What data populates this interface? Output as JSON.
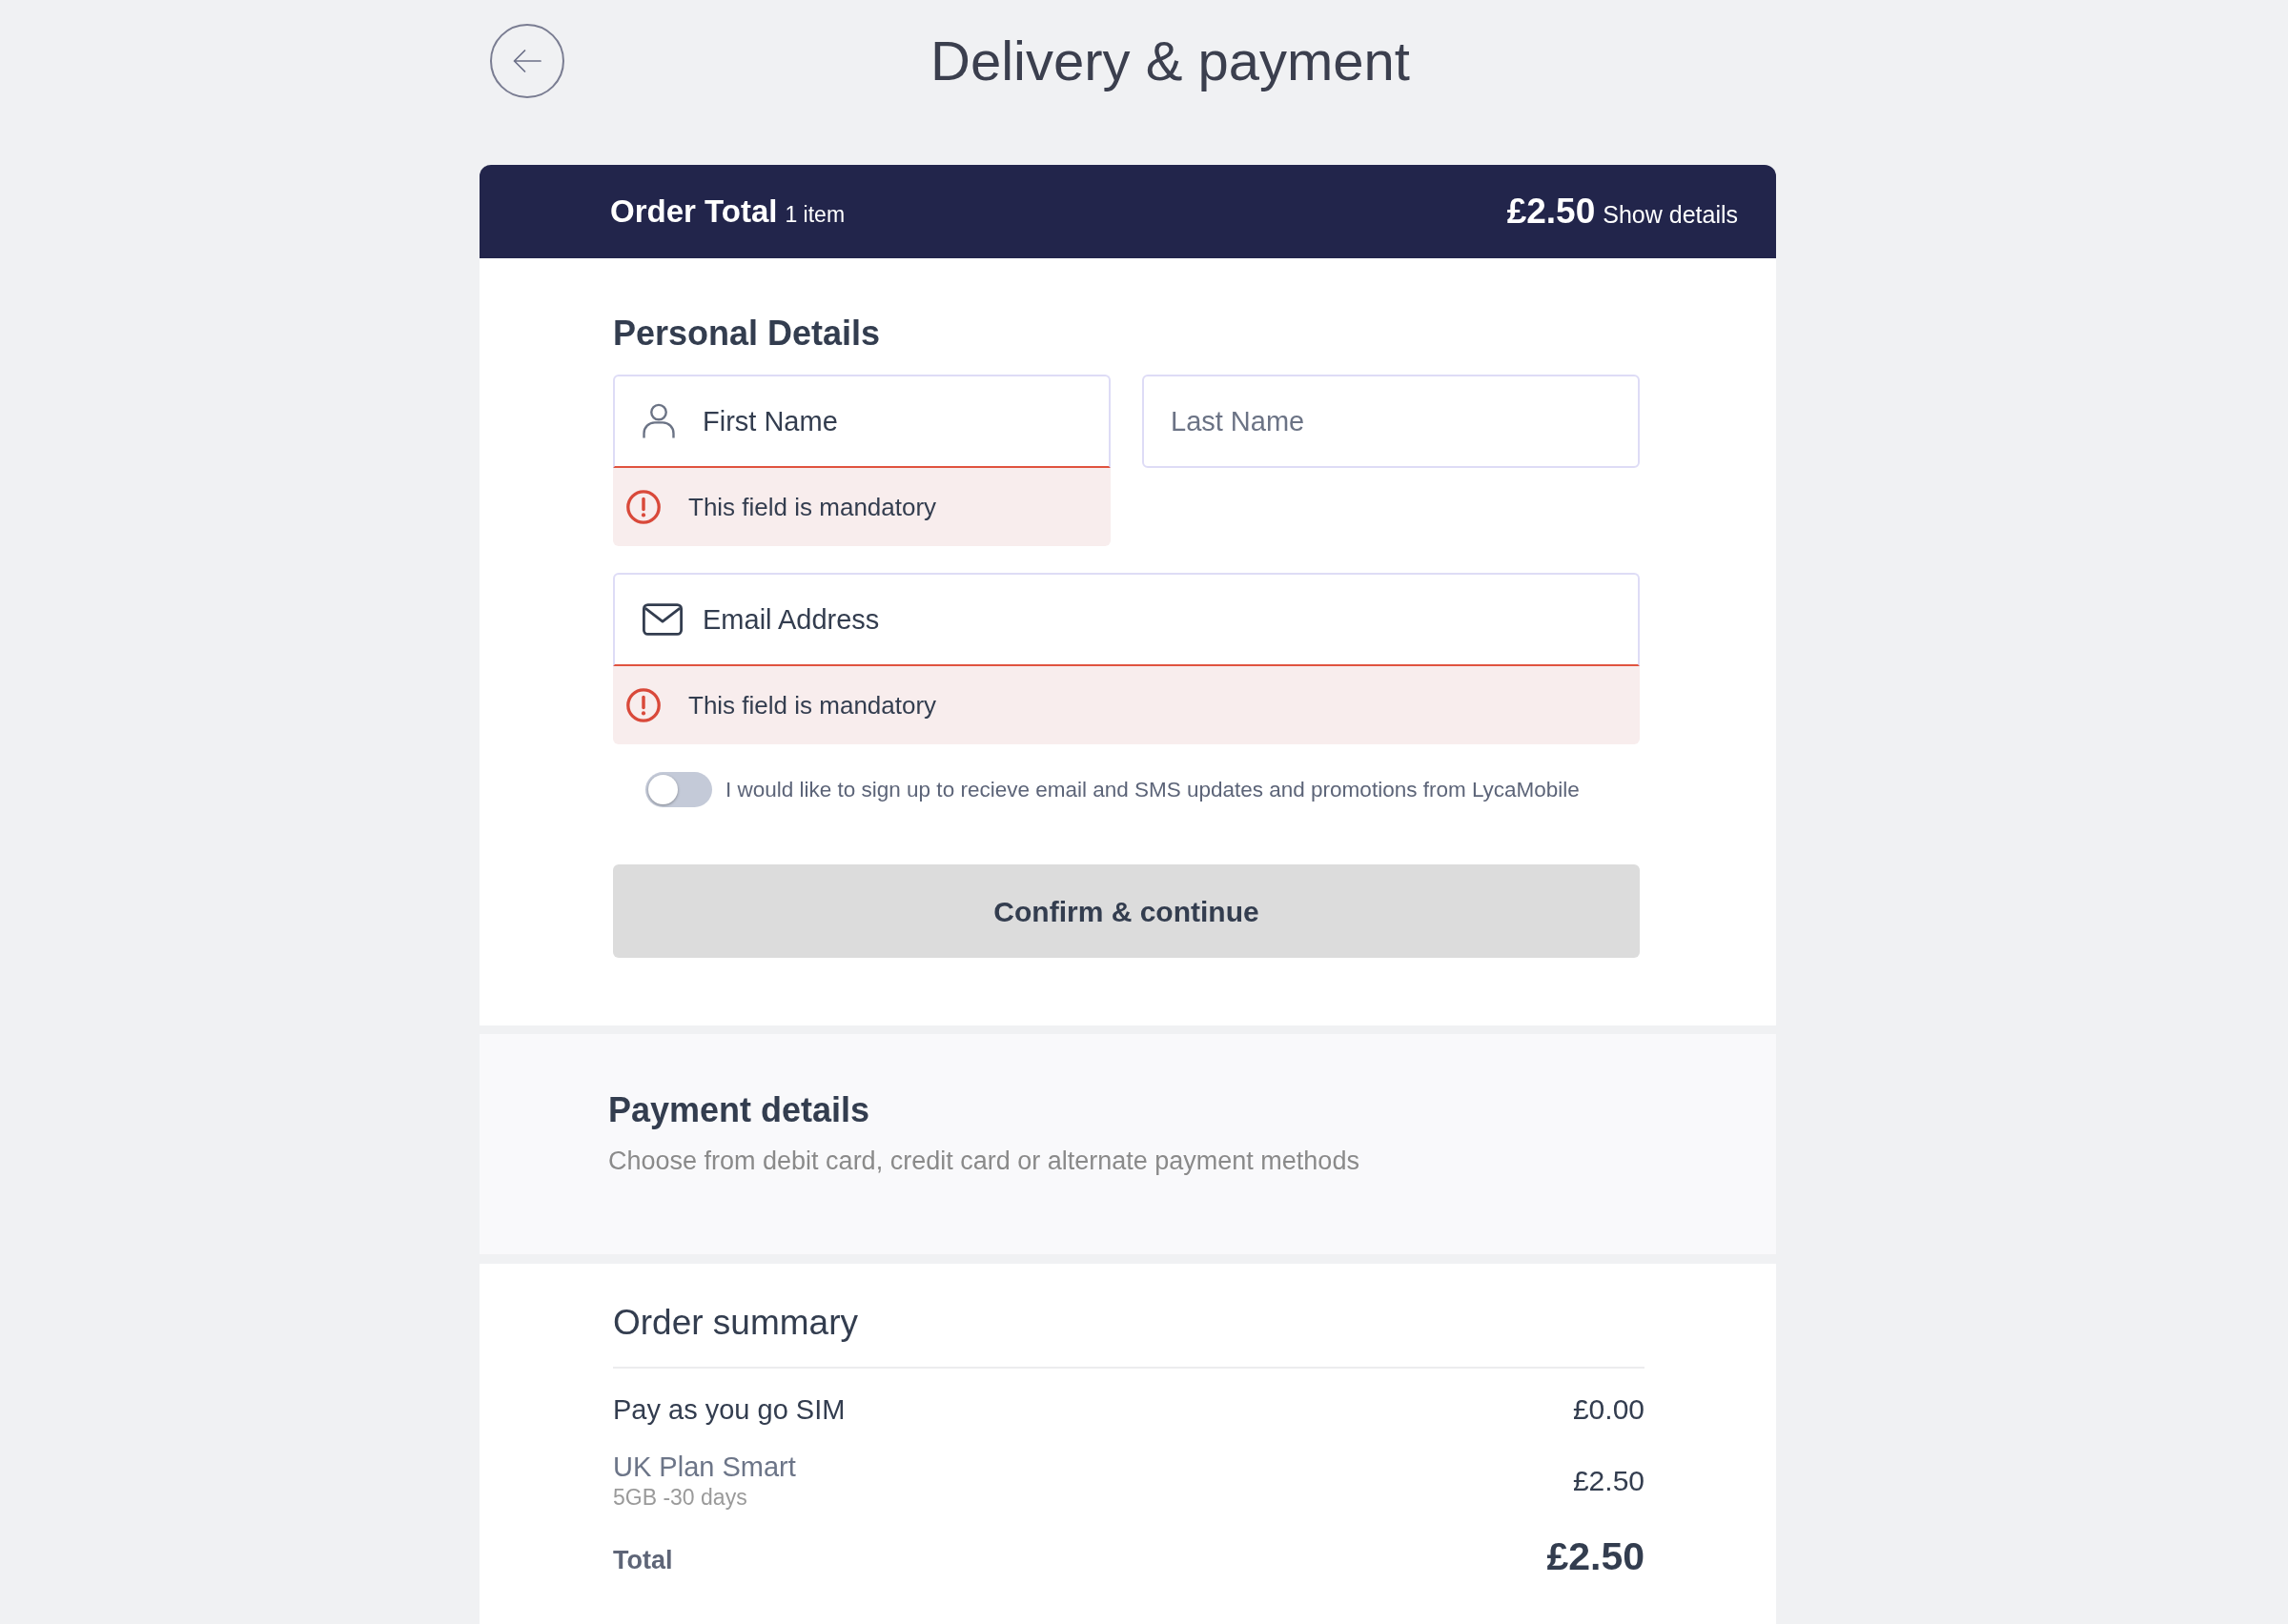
{
  "header": {
    "title": "Delivery & payment"
  },
  "order_bar": {
    "label": "Order Total",
    "item_count": "1 item",
    "amount": "£2.50",
    "link": "Show details"
  },
  "personal_details": {
    "title": "Personal Details",
    "rows": [
      {
        "fields": [
          {
            "kind": "firstname",
            "placeholder": "First Name",
            "error": "This field is mandatory"
          },
          {
            "kind": "lastname",
            "placeholder": "Last Name"
          }
        ]
      },
      {
        "fields": [
          {
            "kind": "email",
            "placeholder": "Email Address",
            "error": "This field is mandatory"
          }
        ]
      }
    ],
    "toggle": {
      "label": "I would like to sign up to recieve email and SMS updates and promotions from LycaMobile",
      "on": false
    },
    "button": {
      "label": "Confirm & continue",
      "disabled": true
    }
  },
  "payment_details": {
    "title": "Payment details",
    "subtitle": "Choose from debit card, credit card or alternate payment methods"
  },
  "order_summary": {
    "title": "Order summary",
    "items": [
      {
        "kind": "product",
        "name": "Pay as you go SIM",
        "price": "£0.00"
      },
      {
        "kind": "plan",
        "name": "UK Plan Smart",
        "detail": "5GB -30 days",
        "price": "£2.50"
      }
    ],
    "total": {
      "label": "Total",
      "amount": "£2.50"
    }
  }
}
